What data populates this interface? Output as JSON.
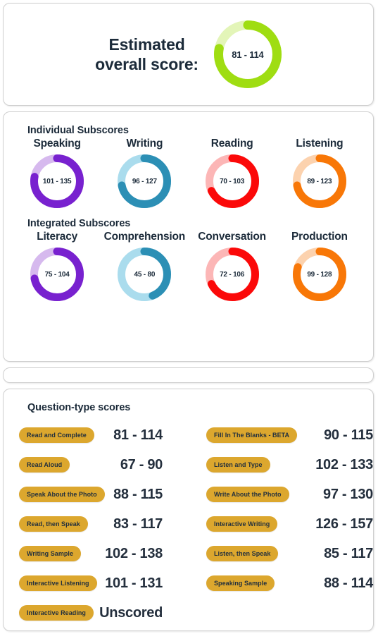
{
  "overall": {
    "title_line1": "Estimated",
    "title_line2": "overall score:",
    "score": "81 - 114",
    "percent": 78,
    "color": "#9fdd12",
    "track_color": "#e3f5b8"
  },
  "individual": {
    "section_title": "Individual Subscores",
    "items": [
      {
        "label": "Speaking",
        "score": "101 - 135",
        "percent": 78,
        "color": "#7821cf",
        "track_color": "#d6b9ee"
      },
      {
        "label": "Writing",
        "score": "96 - 127",
        "percent": 72,
        "color": "#2c8fb5",
        "track_color": "#aadced"
      },
      {
        "label": "Reading",
        "score": "70 - 103",
        "percent": 68,
        "color": "#fb0909",
        "track_color": "#fcb6b6"
      },
      {
        "label": "Listening",
        "score": "89 - 123",
        "percent": 72,
        "color": "#f87707",
        "track_color": "#fcd2ae"
      }
    ]
  },
  "integrated": {
    "section_title": "Integrated Subscores",
    "items": [
      {
        "label": "Literacy",
        "score": "75 - 104",
        "percent": 72,
        "color": "#7821cf",
        "track_color": "#d6b9ee"
      },
      {
        "label": "Comprehension",
        "score": "45 - 80",
        "percent": 44,
        "color": "#2c8fb5",
        "track_color": "#aadced"
      },
      {
        "label": "Conversation",
        "score": "72 - 106",
        "percent": 68,
        "color": "#fb0909",
        "track_color": "#fcb6b6"
      },
      {
        "label": "Production",
        "score": "99 - 128",
        "percent": 80,
        "color": "#f87707",
        "track_color": "#fcd2ae"
      }
    ]
  },
  "question_types": {
    "section_title": "Question-type scores",
    "left": [
      {
        "label": "Read and Complete",
        "score": "81 - 114"
      },
      {
        "label": "Read Aloud",
        "score": "67 - 90"
      },
      {
        "label": "Speak About the Photo",
        "score": "88 - 115"
      },
      {
        "label": "Read, then Speak",
        "score": "83 - 117"
      },
      {
        "label": "Writing Sample",
        "score": "102 - 138"
      },
      {
        "label": "Interactive Listening",
        "score": "101 - 131"
      },
      {
        "label": "Interactive Reading",
        "score": "Unscored"
      }
    ],
    "right": [
      {
        "label": "Fill In The Blanks - BETA",
        "score": "90 - 115"
      },
      {
        "label": "Listen and Type",
        "score": "102 - 133"
      },
      {
        "label": "Write About the Photo",
        "score": "97 - 130"
      },
      {
        "label": "Interactive Writing",
        "score": "126 - 157"
      },
      {
        "label": "Listen, then Speak",
        "score": "85 - 117"
      },
      {
        "label": "Speaking Sample",
        "score": "88 - 114"
      }
    ]
  }
}
